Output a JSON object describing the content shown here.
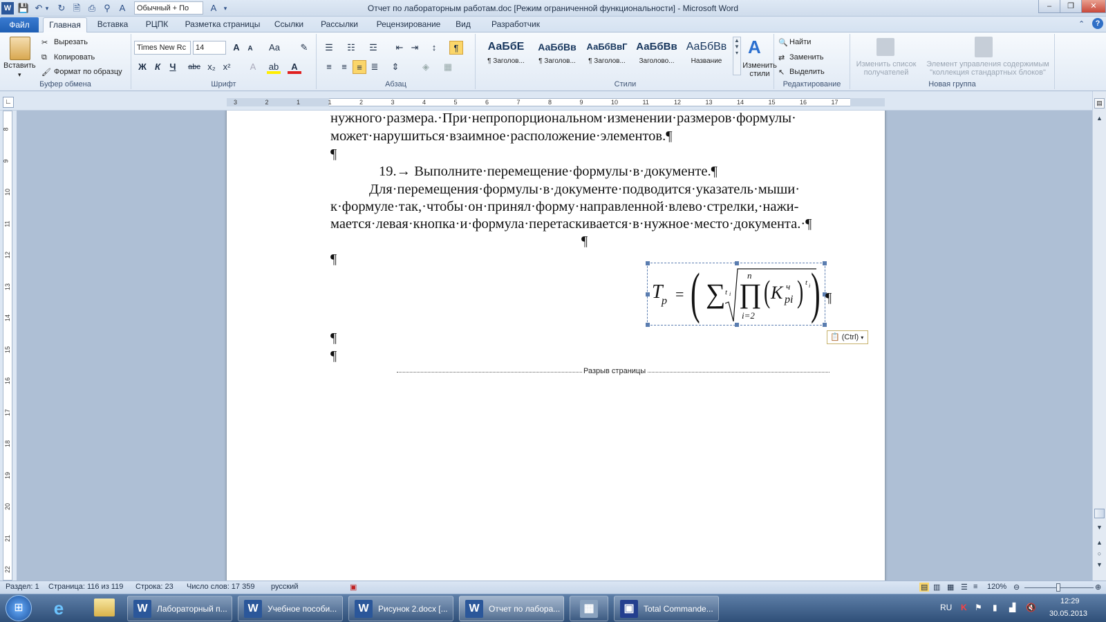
{
  "window": {
    "title": "Отчет по лабораторным работам.doc [Режим ограниченной функциональности]  -  Microsoft Word"
  },
  "qat": {
    "style_combo": "Обычный + По"
  },
  "tabs": [
    {
      "label": "Файл"
    },
    {
      "label": "Главная"
    },
    {
      "label": "Вставка"
    },
    {
      "label": "РЦПК"
    },
    {
      "label": "Разметка страницы"
    },
    {
      "label": "Ссылки"
    },
    {
      "label": "Рассылки"
    },
    {
      "label": "Рецензирование"
    },
    {
      "label": "Вид"
    },
    {
      "label": "Разработчик"
    }
  ],
  "ribbon": {
    "clipboard": {
      "paste": "Вставить",
      "cut": "Вырезать",
      "copy": "Копировать",
      "format_painter": "Формат по образцу",
      "label": "Буфер обмена"
    },
    "font": {
      "name": "Times New Rc",
      "size": "14",
      "label": "Шрифт",
      "bold": "Ж",
      "italic": "К",
      "underline": "Ч",
      "strike": "abc",
      "sub": "x₂",
      "sup": "x²",
      "grow": "A",
      "shrink": "A",
      "case": "Aa"
    },
    "paragraph": {
      "label": "Абзац",
      "pilcrow": "¶"
    },
    "styles": {
      "label": "Стили",
      "items": [
        {
          "preview": "АаБбЕ",
          "name": "¶ Заголов..."
        },
        {
          "preview": "АаБбВв",
          "name": "¶ Заголов..."
        },
        {
          "preview": "АаБбВвГ",
          "name": "¶ Заголов..."
        },
        {
          "preview": "АаБбВв",
          "name": "Заголово..."
        },
        {
          "preview": "АаБбВв",
          "name": "Название"
        }
      ],
      "change": "Изменить стили"
    },
    "editing": {
      "label": "Редактирование",
      "find": "Найти",
      "replace": "Заменить",
      "select": "Выделить"
    },
    "newgroup": {
      "label": "Новая группа",
      "change_list": "Изменить список получателей",
      "content_control": "Элемент управления содержимым \"коллекция стандартных блоков\""
    }
  },
  "ruler": {
    "labels": [
      "3",
      "2",
      "1",
      "1",
      "2",
      "3",
      "4",
      "5",
      "6",
      "7",
      "8",
      "9",
      "10",
      "11",
      "12",
      "13",
      "14",
      "15",
      "16",
      "17"
    ]
  },
  "vruler": {
    "labels": [
      "8",
      "9",
      "10",
      "11",
      "12",
      "13",
      "14",
      "15",
      "16",
      "17",
      "18",
      "19",
      "20",
      "21",
      "22"
    ]
  },
  "document": {
    "line1": "нужного·размера.·При·непропорциональном·изменении·размеров·формулы·",
    "line2": "может·нарушиться·взаимное·расположение·элементов.¶",
    "pil": "¶",
    "item19": "19.→ Выполните·перемещение·формулы·в·документе.¶",
    "para1": "Для·перемещения·формулы·в·документе·подводится·указатель·мыши·",
    "para2": "к·формуле·так,·чтобы·он·принял·форму·направленной·влево·стрелки,·нажи-",
    "para3": "мается·левая·кнопка·и·формула·перетаскивается·в·нужное·место·документа.·¶",
    "formula": {
      "T": "T",
      "p": "p",
      "eq": "=",
      "sum": "∑",
      "ti": "t",
      "i": "i",
      "n": "n",
      "prod": "∏",
      "lower": "i=2",
      "K": "K",
      "ch": "ч",
      "pi": "pi"
    },
    "paste_options": "(Ctrl)",
    "page_break": "Разрыв страницы"
  },
  "status": {
    "section": "Раздел: 1",
    "page": "Страница: 116 из 119",
    "line": "Строка: 23",
    "words": "Число слов: 17 359",
    "lang": "русский",
    "zoom": "120%"
  },
  "taskbar": {
    "items": [
      {
        "label": "Лабораторный п..."
      },
      {
        "label": "Учебное пособи..."
      },
      {
        "label": "Рисунок 2.docx [..."
      },
      {
        "label": "Отчет по лабора..."
      },
      {
        "label": ""
      },
      {
        "label": "Total Commande..."
      }
    ],
    "lang": "RU",
    "time": "12:29",
    "date": "30.05.2013"
  }
}
